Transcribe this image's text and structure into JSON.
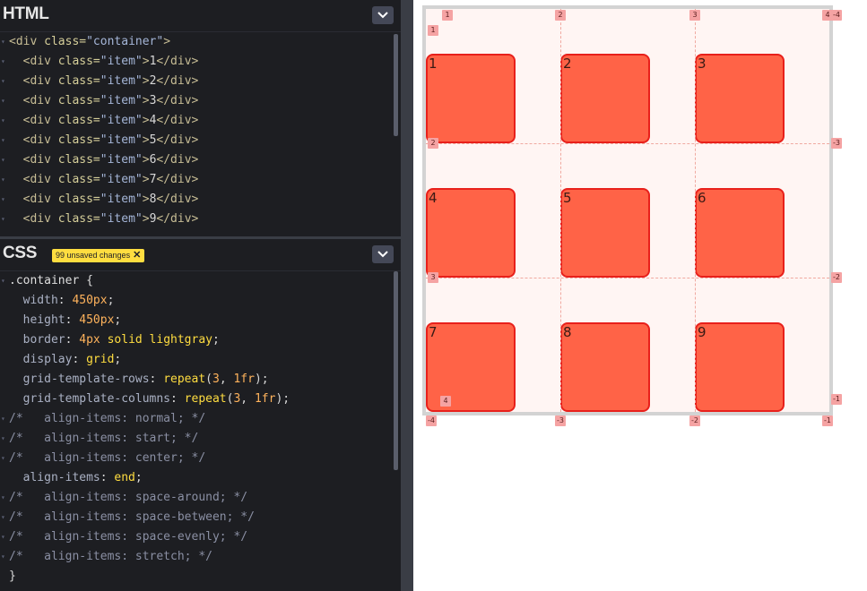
{
  "html_pane": {
    "title": "HTML",
    "lines": [
      {
        "indent": "",
        "open_tag": "<div",
        "attr": " class=",
        "val": "\"container\"",
        "close": ">",
        "text": "",
        "end": ""
      },
      {
        "indent": "  ",
        "open_tag": "<div",
        "attr": " class=",
        "val": "\"item\"",
        "close": ">",
        "text": "1",
        "end": "</div>"
      },
      {
        "indent": "  ",
        "open_tag": "<div",
        "attr": " class=",
        "val": "\"item\"",
        "close": ">",
        "text": "2",
        "end": "</div>"
      },
      {
        "indent": "  ",
        "open_tag": "<div",
        "attr": " class=",
        "val": "\"item\"",
        "close": ">",
        "text": "3",
        "end": "</div>"
      },
      {
        "indent": "  ",
        "open_tag": "<div",
        "attr": " class=",
        "val": "\"item\"",
        "close": ">",
        "text": "4",
        "end": "</div>"
      },
      {
        "indent": "  ",
        "open_tag": "<div",
        "attr": " class=",
        "val": "\"item\"",
        "close": ">",
        "text": "5",
        "end": "</div>"
      },
      {
        "indent": "  ",
        "open_tag": "<div",
        "attr": " class=",
        "val": "\"item\"",
        "close": ">",
        "text": "6",
        "end": "</div>"
      },
      {
        "indent": "  ",
        "open_tag": "<div",
        "attr": " class=",
        "val": "\"item\"",
        "close": ">",
        "text": "7",
        "end": "</div>"
      },
      {
        "indent": "  ",
        "open_tag": "<div",
        "attr": " class=",
        "val": "\"item\"",
        "close": ">",
        "text": "8",
        "end": "</div>"
      },
      {
        "indent": "  ",
        "open_tag": "<div",
        "attr": " class=",
        "val": "\"item\"",
        "close": ">",
        "text": "9",
        "end": "</div>"
      }
    ]
  },
  "css_pane": {
    "title": "CSS",
    "unsaved_badge": "99 unsaved changes",
    "unsaved_close": "✕",
    "lines": [
      {
        "kind": "selector",
        "text": ".container {"
      },
      {
        "kind": "decl",
        "prop": "width",
        "parts": [
          {
            "t": "num",
            "v": "450px"
          }
        ]
      },
      {
        "kind": "decl",
        "prop": "height",
        "parts": [
          {
            "t": "num",
            "v": "450px"
          }
        ]
      },
      {
        "kind": "decl",
        "prop": "border",
        "parts": [
          {
            "t": "num",
            "v": "4px"
          },
          {
            "t": "kw",
            "v": " solid lightgray"
          }
        ]
      },
      {
        "kind": "decl",
        "prop": "display",
        "parts": [
          {
            "t": "kw",
            "v": "grid"
          }
        ]
      },
      {
        "kind": "decl",
        "prop": "grid-template-rows",
        "parts": [
          {
            "t": "fn",
            "v": "repeat"
          },
          {
            "t": "punc",
            "v": "("
          },
          {
            "t": "num",
            "v": "3"
          },
          {
            "t": "punc",
            "v": ", "
          },
          {
            "t": "num",
            "v": "1fr"
          },
          {
            "t": "punc",
            "v": ")"
          }
        ]
      },
      {
        "kind": "decl",
        "prop": "grid-template-columns",
        "parts": [
          {
            "t": "fn",
            "v": "repeat"
          },
          {
            "t": "punc",
            "v": "("
          },
          {
            "t": "num",
            "v": "3"
          },
          {
            "t": "punc",
            "v": ", "
          },
          {
            "t": "num",
            "v": "1fr"
          },
          {
            "t": "punc",
            "v": ")"
          }
        ]
      },
      {
        "kind": "comment",
        "text": "/*   align-items: normal; */"
      },
      {
        "kind": "comment",
        "text": "/*   align-items: start; */"
      },
      {
        "kind": "comment",
        "text": "/*   align-items: center; */"
      },
      {
        "kind": "decl",
        "prop": "align-items",
        "parts": [
          {
            "t": "kw",
            "v": "end"
          }
        ]
      },
      {
        "kind": "comment",
        "text": "/*   align-items: space-around; */"
      },
      {
        "kind": "comment",
        "text": "/*   align-items: space-between; */"
      },
      {
        "kind": "comment",
        "text": "/*   align-items: space-evenly; */"
      },
      {
        "kind": "comment",
        "text": "/*   align-items: stretch; */"
      },
      {
        "kind": "close",
        "text": "}"
      }
    ]
  },
  "preview": {
    "items": [
      "1",
      "2",
      "3",
      "4",
      "5",
      "6",
      "7",
      "8",
      "9"
    ],
    "line_labels_top": [
      "1",
      "2",
      "3",
      "4"
    ],
    "line_labels_bottom": [
      "-4",
      "-3",
      "-2",
      "-1"
    ],
    "line_labels_left": [
      "1",
      "2",
      "3",
      "4"
    ],
    "line_labels_right": [
      "-4",
      "-3",
      "-2",
      "-1"
    ]
  },
  "icons": {
    "collapse": "chevron-down-icon",
    "badge_close": "close-icon"
  },
  "colors": {
    "item_fill": "#ff6347",
    "item_border": "#e8201b",
    "badge": "#ffdd40",
    "editor_bg": "#1d1e22"
  }
}
